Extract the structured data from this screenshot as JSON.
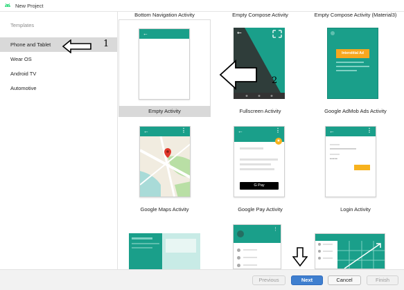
{
  "window": {
    "title": "New Project"
  },
  "sidebar": {
    "header": "Templates",
    "items": [
      {
        "label": "Phone and Tablet",
        "selected": true
      },
      {
        "label": "Wear OS",
        "selected": false
      },
      {
        "label": "Android TV",
        "selected": false
      },
      {
        "label": "Automotive",
        "selected": false
      }
    ]
  },
  "annotations": {
    "num1": "1",
    "num2": "2"
  },
  "templates": {
    "row0": [
      "Bottom Navigation Activity",
      "Empty Compose Activity",
      "Empty Compose Activity (Material3)"
    ],
    "row1": [
      "Empty Activity",
      "Fullscreen Activity",
      "Google AdMob Ads Activity"
    ],
    "row2": [
      "Google Maps Activity",
      "Google Pay Activity",
      "Login Activity"
    ],
    "admob_label": "Interstitial Ad",
    "gpay_label": "G Pay"
  },
  "footer": {
    "previous": "Previous",
    "next": "Next",
    "cancel": "Cancel",
    "finish": "Finish"
  },
  "colors": {
    "accent": "#1a9f8a",
    "primary_button": "#3f7fcf",
    "selection": "#d9d9d9"
  }
}
